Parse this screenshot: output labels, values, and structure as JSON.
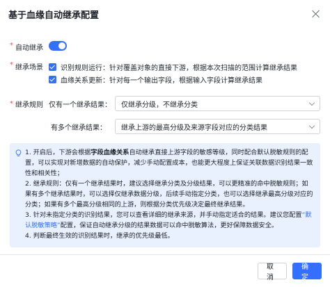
{
  "dialog": {
    "title": "基于血缘自动继承配置"
  },
  "auto_inherit": {
    "required_mark": "*",
    "label": "自动继承",
    "enabled": true
  },
  "scenario": {
    "required_mark": "*",
    "label": "继承场景",
    "options": [
      {
        "text": "识别规则运行：针对覆盖对象的直接下游，根据本次扫描的范围计算继承结果",
        "checked": true
      },
      {
        "text": "血缘关系更新：针对每一个输出字段，根据输入字段计算继承结果",
        "checked": true
      }
    ]
  },
  "rules": {
    "required_mark": "*",
    "label": "继承规则",
    "single_label": "仅有一个继承结果：",
    "single_value": "仅继承分级，不继承分类",
    "multi_label": "有多个继承结果：",
    "multi_value": "继承上游的最高分级及来源字段对应的分类结果"
  },
  "info": {
    "p1_a": "1. 开启后，下游会根据",
    "p1_b": "字段血缘关系",
    "p1_c": "自动继承直接上游字段的敏感等级，同时配合默认脱敏规则的配置，可以实现对新增数据的自动保护，减少手动配置成本，也能更大程度上保证关联数据识别结果一致性和相关性；",
    "p2": "2. 继承规则：仅有一个继承结果时，建议选择继承分类及分级结果，可以更精准的命中脱敏规则；如果有多个继承结果时，可以选择仅继承数据分级，后续手动指定分类，也可以选择继承最高分级对应的分类；如果有多个最高分级相同的上游，则根据分类优先级决定最终继承结果。",
    "p3_a": "3. 针对未指定分类的识别结果，您可以查看详细的继承来源，并手动指定适合的结果。建议您配置",
    "p3_link": "“默认脱敏策略”",
    "p3_c": "配置，保证自动继承分级的结果数据可以命中脱敏算法，更好保障数据安全。",
    "p4": "4. 判断最终生效的识别结果时，继承的优先级最低。"
  },
  "footer": {
    "cancel": "取 消",
    "ok": "确 定"
  },
  "colors": {
    "primary": "#3370ff",
    "required": "#f54a45",
    "info_bg": "#e9f1ff"
  }
}
